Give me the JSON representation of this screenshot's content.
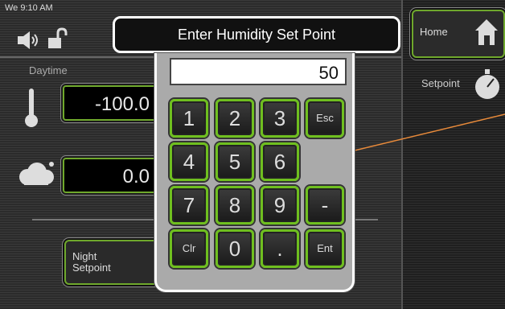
{
  "status": {
    "time": "We 9:10 AM"
  },
  "left": {
    "section_label": "Daytime",
    "temp_value": "-100.0",
    "humidity_value": "0.0"
  },
  "night_button": {
    "line1": "Night",
    "line2": "Setpoint"
  },
  "right": {
    "home_label": "Home",
    "setpoint_label": "Setpoint"
  },
  "keypad": {
    "title": "Enter Humidity Set Point",
    "display_value": "50",
    "keys": {
      "k1": "1",
      "k2": "2",
      "k3": "3",
      "esc": "Esc",
      "k4": "4",
      "k5": "5",
      "k6": "6",
      "k7": "7",
      "k8": "8",
      "k9": "9",
      "minus": "-",
      "clr": "Clr",
      "k0": "0",
      "dot": ".",
      "ent": "Ent"
    }
  },
  "colors": {
    "accent_green": "#6fbf1f",
    "annotation_arrow": "#e88a3a"
  }
}
